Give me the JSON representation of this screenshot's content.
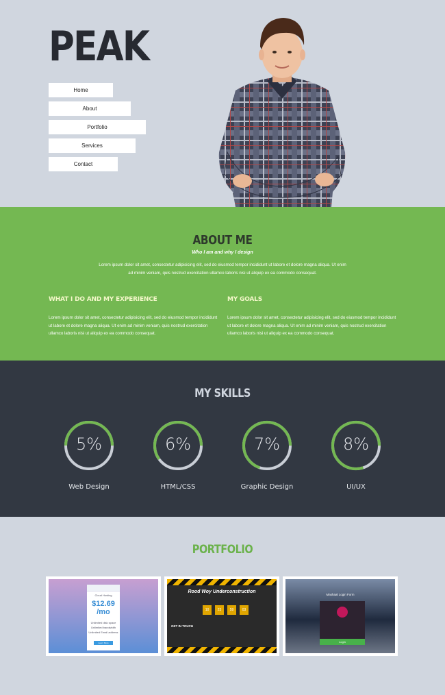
{
  "brand": "PEAK",
  "nav": [
    {
      "label": "Home"
    },
    {
      "label": "About"
    },
    {
      "label": "Portfolio"
    },
    {
      "label": "Services"
    },
    {
      "label": "Contact"
    }
  ],
  "about": {
    "title": "ABOUT ME",
    "subtitle": "Who I am and why I design",
    "intro": "Lorem ipsum dolor sit amet, consectetur adipisicing elit, sed do eiusmod tempor incididunt ut labore et dolore magna aliqua. Ut enim ad minim veniam, quis nostrud exercitation ullamco laboris nisi ut aliquip ex ea commodo consequat.",
    "columns": [
      {
        "heading": "WHAT I DO AND MY EXPERIENCE",
        "text": "Lorem ipsum dolor sit amet, consectetur adipisicing elit, sed do eiusmod tempor incididunt ut labore et dolore magna aliqua. Ut enim ad minim veniam, quis nostrud exercitation ullamco laboris nisi ut aliquip ex ea commodo consequat."
      },
      {
        "heading": "MY GOALS",
        "text": "Lorem ipsum dolor sit amet, consectetur adipisicing elit, sed do eiusmod tempor incididunt ut labore et dolore magna aliqua. Ut enim ad minim veniam, quis nostrud exercitation ullamco laboris nisi ut aliquip ex ea commodo consequat."
      }
    ]
  },
  "skills": {
    "title": "MY SKILLS",
    "items": [
      {
        "value": "5%",
        "label": "Web Design",
        "fraction": 0.5
      },
      {
        "value": "6%",
        "label": "HTML/CSS",
        "fraction": 0.6
      },
      {
        "value": "7%",
        "label": "Graphic Design",
        "fraction": 0.7
      },
      {
        "value": "8%",
        "label": "UI/UX",
        "fraction": 0.8
      }
    ]
  },
  "portfolio": {
    "title": "PORTFOLIO",
    "items": [
      {
        "card_title": "Cloud Hosting",
        "price": "$12.69 /mo",
        "features": [
          "Unlimited disk space",
          "Unlimited bandwidth",
          "Unlimited Email address"
        ],
        "button": "Learn More"
      },
      {
        "title": "Rood Woy Underconstruction",
        "timer": [
          "10",
          "23",
          "59",
          "03"
        ],
        "section": "GET IN TOUCH"
      },
      {
        "title": "Mashaal Login Form",
        "button": "Login"
      }
    ]
  },
  "colors": {
    "background": "#d0d6df",
    "green": "#74b852",
    "dark": "#323842",
    "accent": "#6bb24b"
  }
}
